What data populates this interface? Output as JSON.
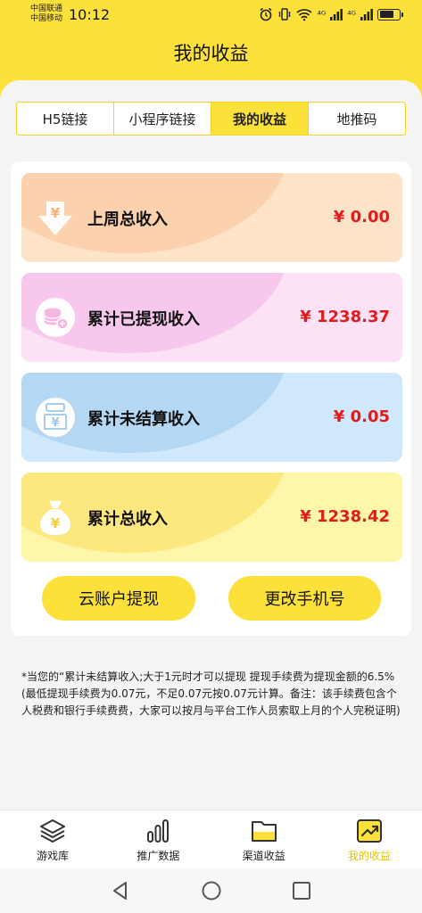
{
  "status_bar": {
    "carrier_1": "中国联通",
    "carrier_2": "中国移动",
    "time": "10:12",
    "net_1": "⁴ᴳ",
    "net_2": "⁴ᴳ"
  },
  "header": {
    "title": "我的收益"
  },
  "tabs": [
    {
      "label": "H5链接",
      "active": false
    },
    {
      "label": "小程序链接",
      "active": false
    },
    {
      "label": "我的收益",
      "active": true
    },
    {
      "label": "地推码",
      "active": false
    }
  ],
  "stats": [
    {
      "label": "上周总收入",
      "value": "¥ 0.00",
      "icon": "down-arrow-yen-icon"
    },
    {
      "label": "累计已提现收入",
      "value": "¥ 1238.37",
      "icon": "coin-stack-plus-icon"
    },
    {
      "label": "累计未结算收入",
      "value": "¥ 0.05",
      "icon": "yen-document-icon"
    },
    {
      "label": "累计总收入",
      "value": "¥ 1238.42",
      "icon": "money-bag-yen-icon"
    }
  ],
  "actions": {
    "withdraw_label": "云账户提现",
    "change_phone_label": "更改手机号"
  },
  "notice": "*当您的“累计未结算收入;大于1元时才可以提现 提现手续费为提现金额的6.5%(最低提现手续费为0.07元，不足0.07元按0.07元计算。备注：该手续费包含个人税费和银行手续费费，大家可以按月与平台工作人员索取上月的个人完税证明)",
  "bottom_nav": [
    {
      "label": "游戏库",
      "icon": "layers-icon",
      "active": false
    },
    {
      "label": "推广数据",
      "icon": "bar-chart-icon",
      "active": false
    },
    {
      "label": "渠道收益",
      "icon": "folder-icon",
      "active": false
    },
    {
      "label": "我的收益",
      "icon": "trend-chart-icon",
      "active": true
    }
  ],
  "colors": {
    "brand_yellow": "#fde13b",
    "amount_red": "#e01b1b",
    "active_nav": "#e9c400"
  }
}
